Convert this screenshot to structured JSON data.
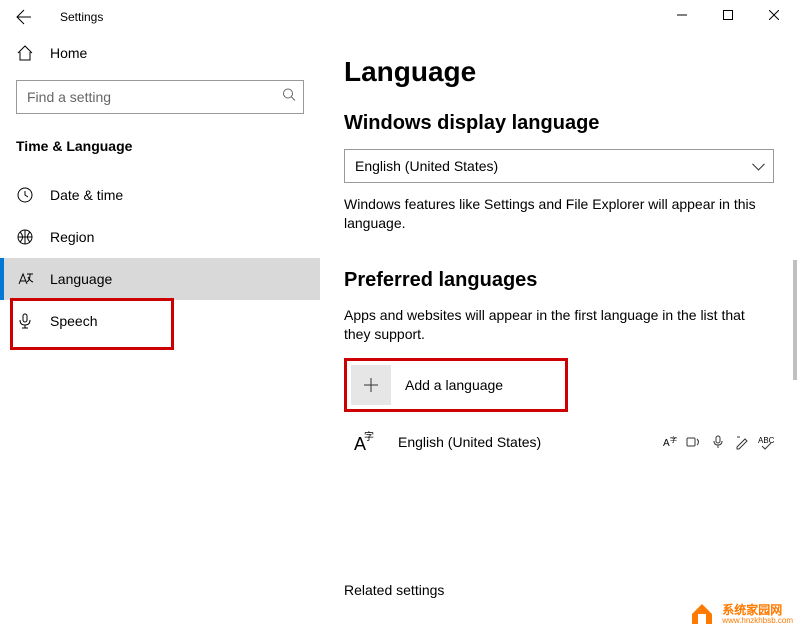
{
  "window": {
    "title": "Settings"
  },
  "sidebar": {
    "home": "Home",
    "search_placeholder": "Find a setting",
    "category": "Time & Language",
    "items": [
      {
        "label": "Date & time"
      },
      {
        "label": "Region"
      },
      {
        "label": "Language"
      },
      {
        "label": "Speech"
      }
    ]
  },
  "main": {
    "title": "Language",
    "display_section": "Windows display language",
    "display_value": "English (United States)",
    "display_desc": "Windows features like Settings and File Explorer will appear in this language.",
    "preferred_section": "Preferred languages",
    "preferred_desc": "Apps and websites will appear in the first language in the list that they support.",
    "add_language": "Add a language",
    "languages": [
      {
        "name": "English (United States)"
      }
    ],
    "related": "Related settings"
  },
  "watermark": {
    "text": "系统家园网",
    "sub": "www.hnzkhbsb.com"
  }
}
